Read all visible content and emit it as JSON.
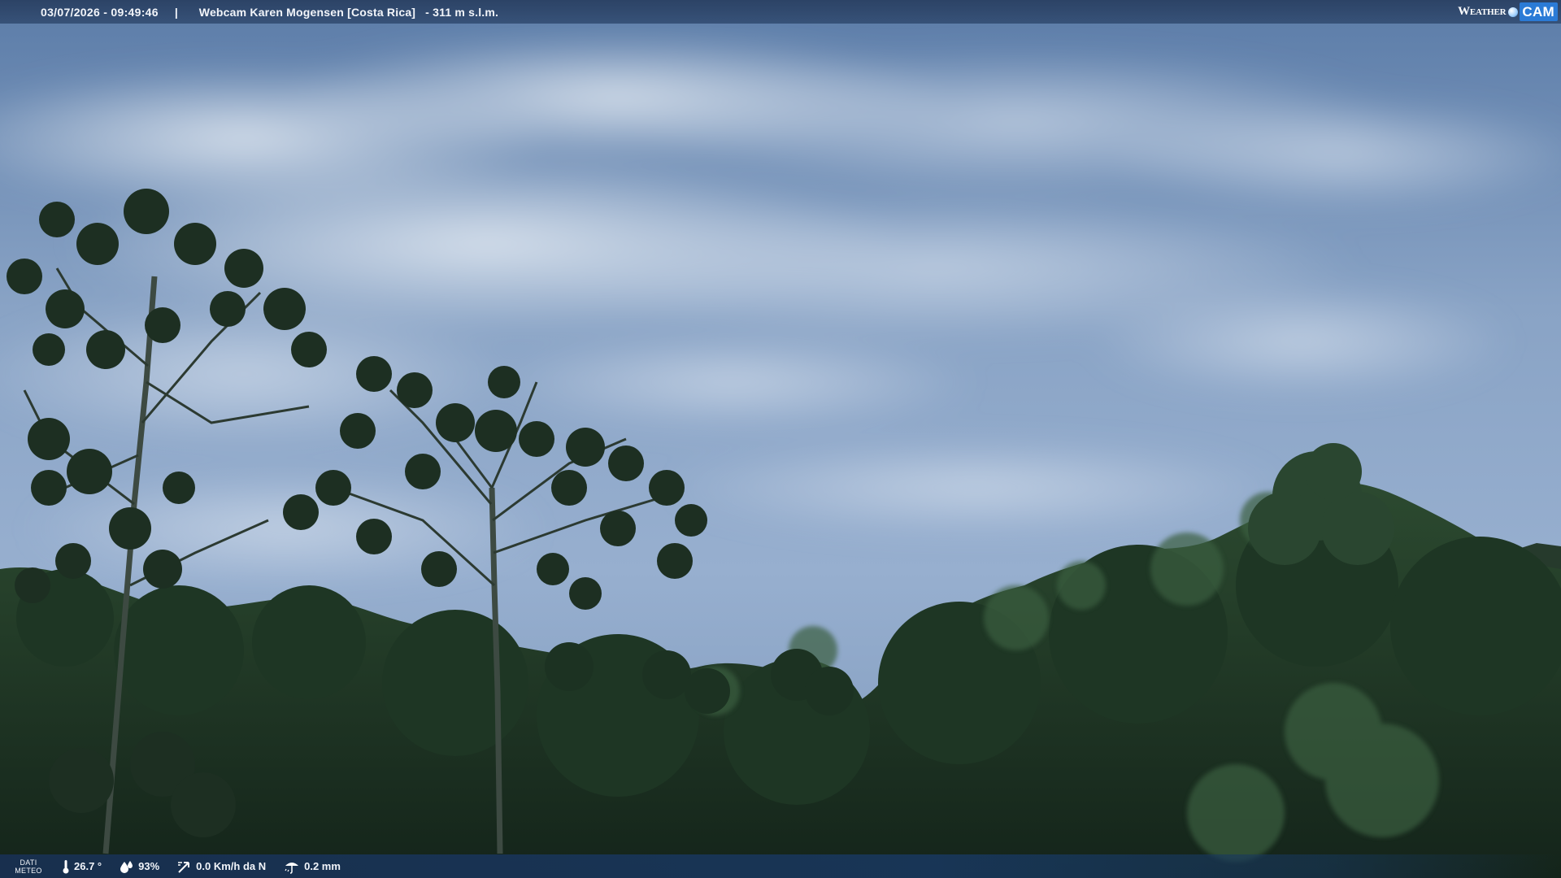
{
  "header": {
    "datetime": "03/07/2026 - 09:49:46",
    "separator": "|",
    "title": "Webcam Karen Mogensen [Costa Rica]",
    "altitude": "- 311 m s.l.m."
  },
  "brand": {
    "word": "Weather",
    "cam": "CAM"
  },
  "footer": {
    "label_line1": "DATI",
    "label_line2": "METEO",
    "temperature": "26.7 °",
    "humidity": "93%",
    "wind": "0.0 Km/h da N",
    "rain": "0.2 mm"
  },
  "colors": {
    "sky_top": "#5a7cab",
    "sky_mid": "#8ea7c9",
    "sky_bottom": "#a9bdd6",
    "forest_dark": "#16271a",
    "forest_mid": "#24402a",
    "forest_light": "#3d6041"
  }
}
